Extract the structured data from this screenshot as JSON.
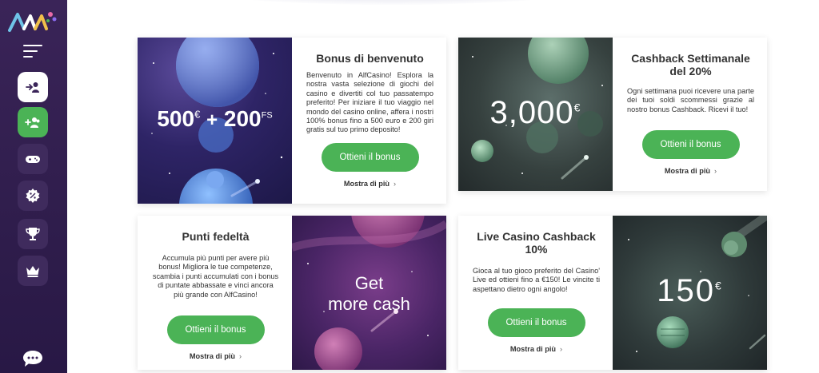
{
  "sidebar": {
    "logo": "ALF",
    "icons": [
      "menu-icon",
      "login-icon",
      "register-icon",
      "gamepad-icon",
      "promotions-icon",
      "trophy-icon",
      "crown-icon",
      "chat-icon"
    ]
  },
  "cards": [
    {
      "title": "Bonus di benvenuto",
      "image_text": {
        "main": "500",
        "currency": "€",
        "plus": "+",
        "fs": "200",
        "fs_unit": "FS"
      },
      "text": "Benvenuto in AlfCasino! Esplora la nostra vasta selezione di giochi del casino e divertiti col tuo passatempo preferito! Per iniziare il tuo viaggio nel mondo del casino online, affera i nostri 100% bonus fino a 500 euro e 200 giri gratis sul tuo primo deposito!",
      "button": "Ottieni il bonus",
      "more": "Mostra di più",
      "chevron": "›"
    },
    {
      "title": "Cashback Settimanale del 20%",
      "image_text": {
        "main": "3,000",
        "currency": "€"
      },
      "text": "Ogni settimana puoi ricevere una parte dei tuoi soldi scommessi grazie al nostro bonus Cashback. Ricevi il tuo!",
      "button": "Ottieni il bonus",
      "more": "Mostra di più",
      "chevron": "›"
    },
    {
      "title": "Punti fedeltà",
      "image_text": {
        "line1": "Get",
        "line2": "more cash"
      },
      "text": "Accumula più punti per avere più bonus! Migliora le tue competenze, scambia i punti accumulati con i bonus di puntate abbassate e vinci ancora più grande con AlfCasino!",
      "button": "Ottieni il bonus",
      "more": "Mostra di più",
      "chevron": "›"
    },
    {
      "title": "Live Casino Cashback 10%",
      "image_text": {
        "main": "150",
        "currency": "€"
      },
      "text": "Gioca al tuo gioco preferito del Casino' Live ed ottieni fino a €150! Le vincite ti aspettano dietro ogni angolo!",
      "button": "Ottieni il bonus",
      "more": "Mostra di più",
      "chevron": "›"
    }
  ]
}
